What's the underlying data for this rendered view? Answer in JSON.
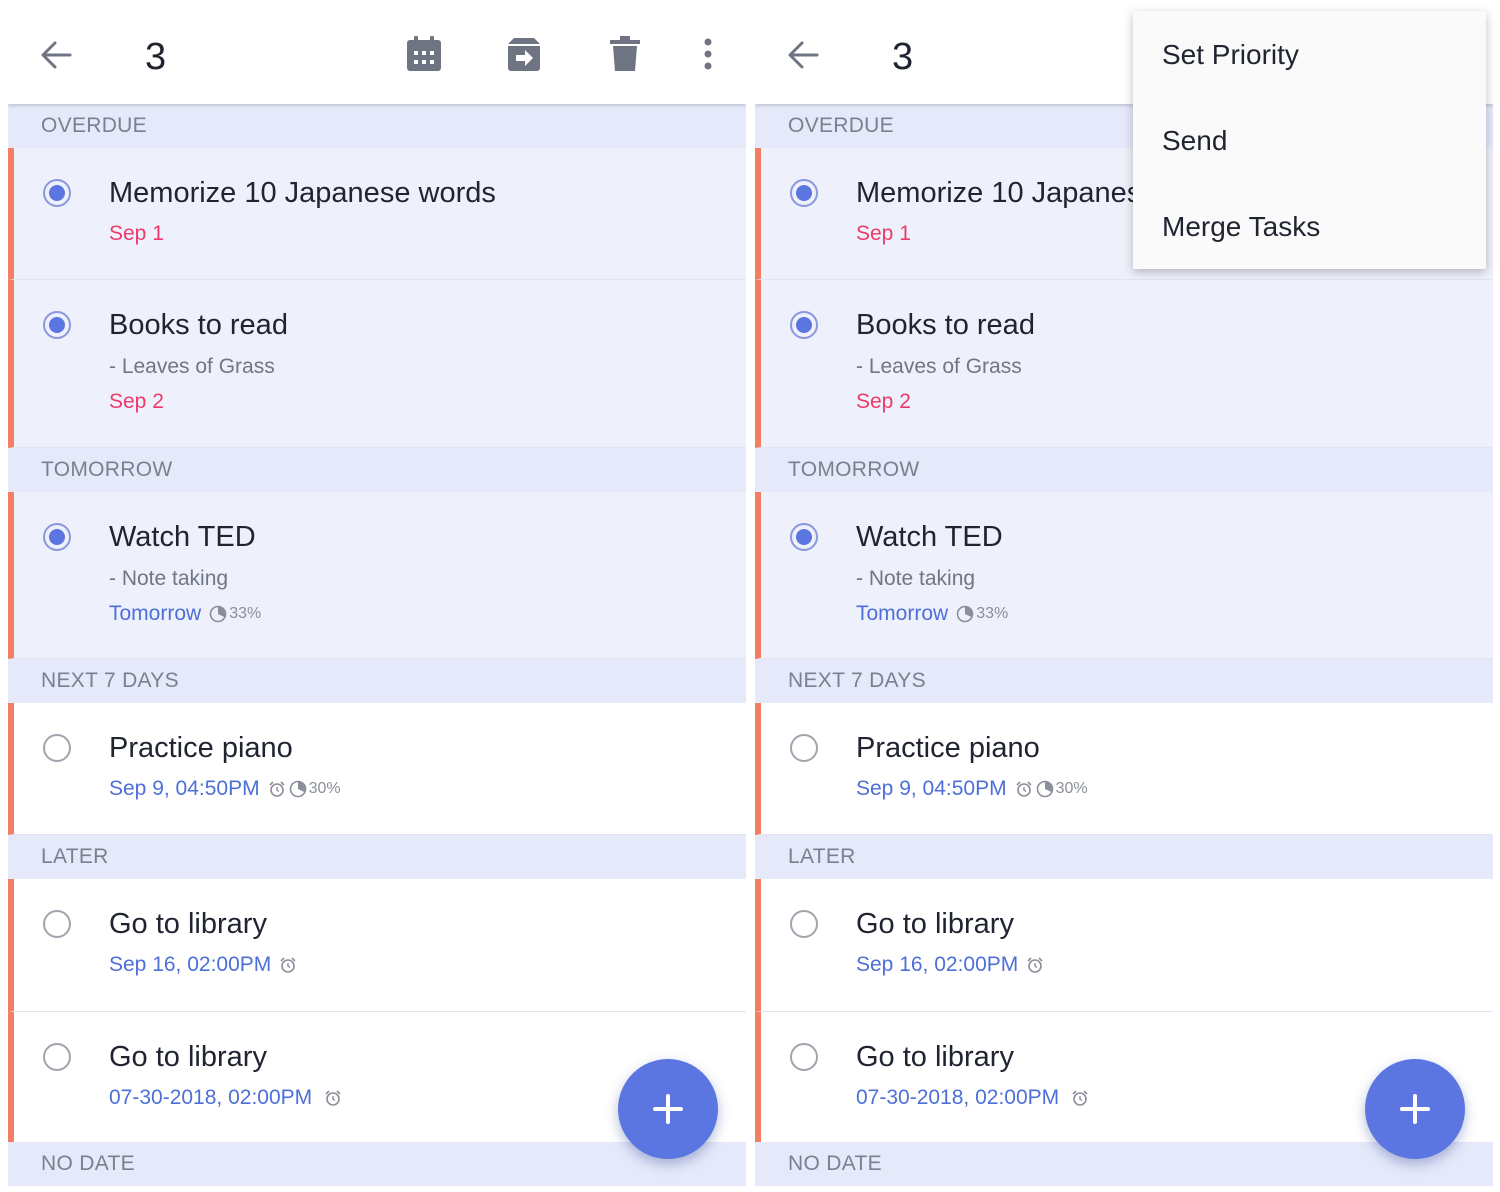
{
  "colors": {
    "accent": "#5b76e1",
    "priority_bar": "#f37e63",
    "overdue_date": "#ec3a6a",
    "future_date": "#4d6fd8",
    "section_bg": "#e5e9fa"
  },
  "appbar": {
    "selected_count": "3",
    "icons": [
      "back-arrow-icon",
      "calendar-icon",
      "move-to-list-icon",
      "trash-icon",
      "more-vert-icon"
    ]
  },
  "sections": {
    "overdue": "OVERDUE",
    "tomorrow": "TOMORROW",
    "next7": "NEXT 7 DAYS",
    "later": "LATER",
    "nodate": "NO DATE"
  },
  "tasks": [
    {
      "title": "Memorize 10 Japanese words",
      "date": "Sep 1",
      "selected": true
    },
    {
      "title": "Books to read",
      "note": "- Leaves of Grass",
      "date": "Sep 2",
      "selected": true
    },
    {
      "title": "Watch TED",
      "note": "- Note taking",
      "date": "Tomorrow",
      "progress": "33%",
      "selected": true
    },
    {
      "title": "Practice piano",
      "date": "Sep 9, 04:50PM",
      "reminder": true,
      "progress": "30%",
      "selected": false
    },
    {
      "title": "Go to library",
      "date": "Sep 16, 02:00PM",
      "reminder": true,
      "selected": false
    },
    {
      "title": "Go to library",
      "date": "07-30-2018, 02:00PM",
      "reminder": true,
      "selected": false
    }
  ],
  "overflow_menu": {
    "items": [
      "Set Priority",
      "Send",
      "Merge Tasks"
    ]
  }
}
